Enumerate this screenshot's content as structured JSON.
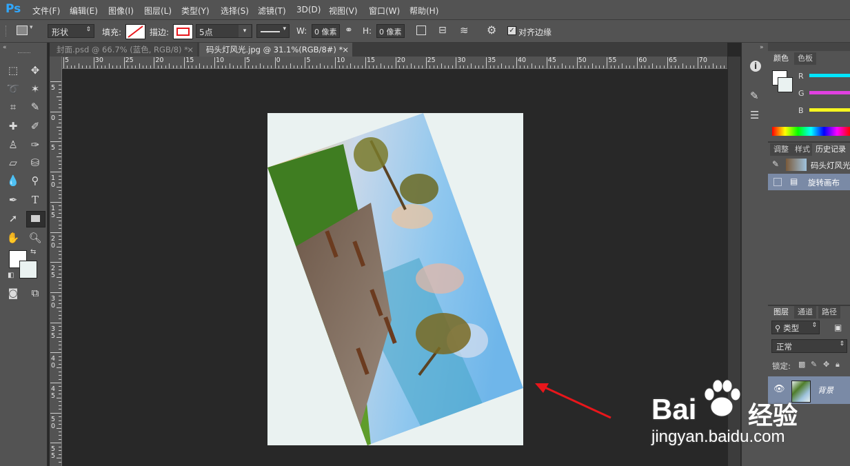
{
  "app": {
    "logo": "Ps"
  },
  "menu": [
    "文件(F)",
    "编辑(E)",
    "图像(I)",
    "图层(L)",
    "类型(Y)",
    "选择(S)",
    "滤镜(T)",
    "3D(D)",
    "视图(V)",
    "窗口(W)",
    "帮助(H)"
  ],
  "options": {
    "mode": "形状",
    "fill_label": "填充:",
    "stroke_label": "描边:",
    "stroke_width": "5点",
    "w_label": "W:",
    "w_value": "0 像素",
    "h_label": "H:",
    "h_value": "0 像素",
    "align_edges": "对齐边缘"
  },
  "tabs": [
    {
      "title": "封面.psd @ 66.7% (蓝色, RGB/8) *",
      "close": "×",
      "active": false
    },
    {
      "title": "码头灯风光.jpg @ 31.1%(RGB/8#) *",
      "close": "×",
      "active": true
    }
  ],
  "ruler": {
    "h_labels": [
      "5",
      "30",
      "25",
      "20",
      "15",
      "10",
      "5",
      "0",
      "5",
      "10",
      "15",
      "20",
      "25",
      "30",
      "35",
      "40",
      "45",
      "50",
      "55",
      "60",
      "65",
      "70"
    ],
    "v_labels": [
      "5",
      "0",
      "5",
      "1 0",
      "1 5",
      "2 0",
      "2 5",
      "3 0",
      "3 5",
      "4 0",
      "4 5",
      "5 0",
      "5 5"
    ]
  },
  "color_panel": {
    "tabs": [
      "颜色",
      "色板"
    ],
    "channels": [
      "R",
      "G",
      "B"
    ],
    "colors": {
      "r": "#00e5ff",
      "g": "#e040e0",
      "b": "#f5f520"
    }
  },
  "history_panel": {
    "tabs": [
      "调整",
      "样式",
      "历史记录"
    ],
    "snapshot": "码头灯风光",
    "items": [
      "旋转画布"
    ]
  },
  "layers_panel": {
    "tabs": [
      "图层",
      "通道",
      "路径"
    ],
    "filter": "类型",
    "blend_mode": "正常",
    "lock_label": "锁定:",
    "layer_name": "背景"
  },
  "watermark": {
    "brand": "Bai",
    "brand2": "经验",
    "url": "jingyan.baidu.com"
  },
  "colors": {
    "accent": "#30a8ff",
    "arrow": "#e8161b",
    "canvas_bg": "#eaf2f1"
  }
}
